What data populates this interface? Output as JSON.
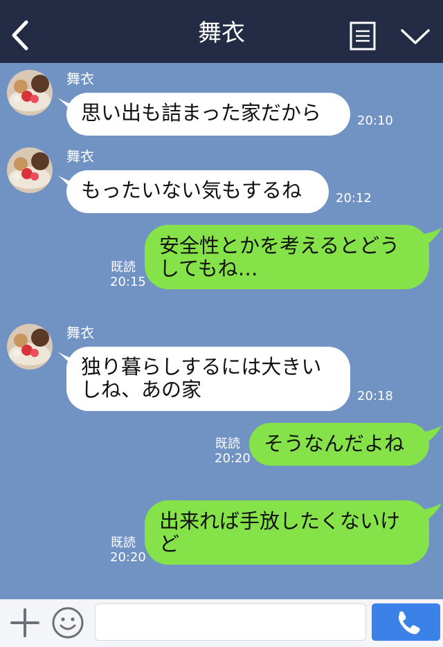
{
  "header": {
    "title": "舞衣",
    "back_icon": "chevron-left-icon",
    "notes_icon": "notes-icon",
    "menu_icon": "chevron-down-icon",
    "background": "#232c44"
  },
  "colors": {
    "chat_background": "#7093c3",
    "incoming_bubble": "#ffffff",
    "outgoing_bubble": "#85e249",
    "call_button": "#3b82e8"
  },
  "messages": [
    {
      "direction": "incoming",
      "sender": "舞衣",
      "lines": [
        "思い出も詰まった家だから"
      ],
      "time": "20:10"
    },
    {
      "direction": "incoming",
      "sender": "舞衣",
      "lines": [
        "もったいない気もするね"
      ],
      "time": "20:12"
    },
    {
      "direction": "outgoing",
      "lines": [
        "安全性とかを考えるとどう",
        "してもね…"
      ],
      "status": "既読",
      "time": "20:15"
    },
    {
      "direction": "incoming",
      "sender": "舞衣",
      "lines": [
        "独り暮らしするには大きい",
        "しね、あの家"
      ],
      "time": "20:18"
    },
    {
      "direction": "outgoing",
      "lines": [
        "そうなんだよね"
      ],
      "status": "既読",
      "time": "20:20"
    },
    {
      "direction": "outgoing",
      "lines": [
        "出来れば手放したくないけ",
        "ど"
      ],
      "status": "既読",
      "time": "20:20"
    }
  ],
  "footer": {
    "plus_icon": "plus-icon",
    "emoji_icon": "smiley-icon",
    "input_value": "",
    "call_icon": "phone-icon"
  }
}
